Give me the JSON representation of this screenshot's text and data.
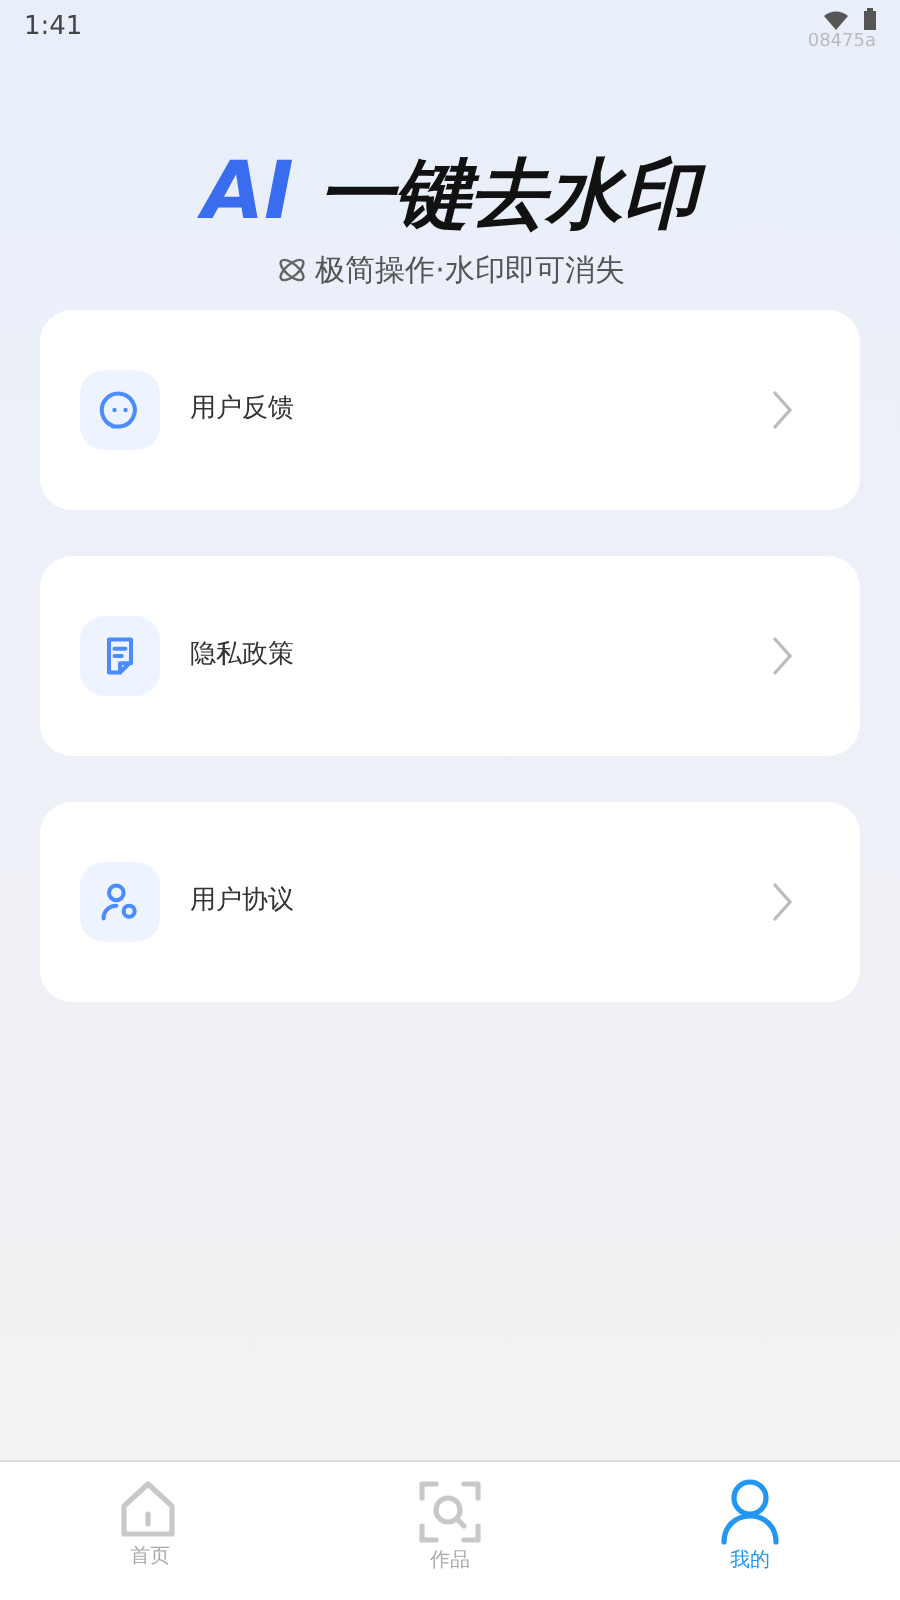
{
  "status_bar": {
    "time": "1:41",
    "code": "08475a"
  },
  "header": {
    "title_accent": "AI",
    "title": "一键去水印",
    "subtitle": "极简操作·水印即可消失"
  },
  "menu": [
    {
      "kind": "feedback",
      "label": "用户反馈"
    },
    {
      "kind": "privacy",
      "label": "隐私政策"
    },
    {
      "kind": "agreement",
      "label": "用户协议"
    }
  ],
  "tab_bar": [
    {
      "kind": "home",
      "label": "首页",
      "selected": false
    },
    {
      "kind": "works",
      "label": "作品",
      "selected": false
    },
    {
      "kind": "me",
      "label": "我的",
      "selected": true
    }
  ]
}
